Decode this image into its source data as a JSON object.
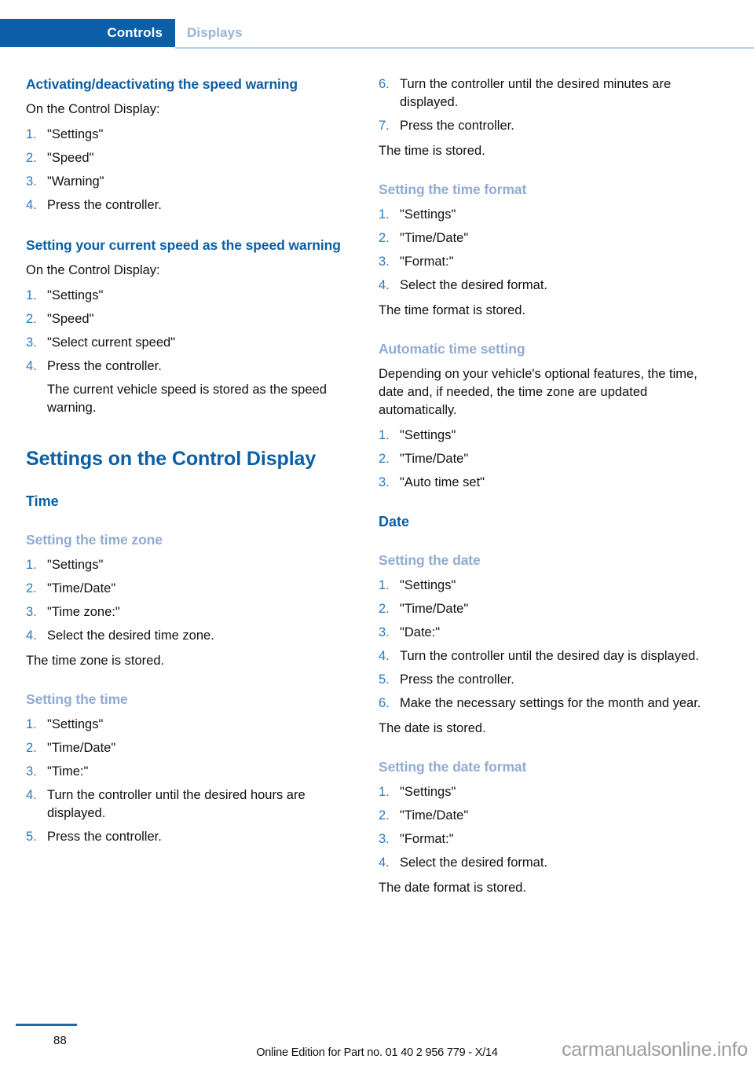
{
  "header": {
    "active_tab": "Controls",
    "inactive_tab": "Displays",
    "accent_color": "#0b5ea8",
    "inactive_color": "#97b4d6"
  },
  "colors": {
    "heading_blue": "#0b5fa5",
    "subheading_light_blue": "#90abd2",
    "list_number_blue": "#2a7ac0",
    "body_black": "#111111",
    "footer_rule_blue": "#1a6ab0",
    "watermark_grey": "#9d9d9d"
  },
  "left_column": {
    "section_speed_warning_toggle": {
      "heading": "Activating/deactivating the speed warning",
      "intro": "On the Control Display:",
      "steps": [
        {
          "num": "1.",
          "text": "\"Settings\""
        },
        {
          "num": "2.",
          "text": "\"Speed\""
        },
        {
          "num": "3.",
          "text": "\"Warning\""
        },
        {
          "num": "4.",
          "text": "Press the controller."
        }
      ]
    },
    "section_current_speed": {
      "heading": "Setting your current speed as the speed warning",
      "intro": "On the Control Display:",
      "steps": [
        {
          "num": "1.",
          "text": "\"Settings\""
        },
        {
          "num": "2.",
          "text": "\"Speed\""
        },
        {
          "num": "3.",
          "text": "\"Select current speed\""
        },
        {
          "num": "4.",
          "text": "Press the controller."
        }
      ],
      "note": "The current vehicle speed is stored as the speed warning."
    },
    "chapter_title": "Settings on the Control Display",
    "section_time_group": {
      "heading": "Time"
    },
    "section_time_zone": {
      "heading": "Setting the time zone",
      "steps": [
        {
          "num": "1.",
          "text": "\"Settings\""
        },
        {
          "num": "2.",
          "text": "\"Time/Date\""
        },
        {
          "num": "3.",
          "text": "\"Time zone:\""
        },
        {
          "num": "4.",
          "text": "Select the desired time zone."
        }
      ],
      "result": "The time zone is stored."
    },
    "section_setting_time": {
      "heading": "Setting the time",
      "steps": [
        {
          "num": "1.",
          "text": "\"Settings\""
        },
        {
          "num": "2.",
          "text": "\"Time/Date\""
        },
        {
          "num": "3.",
          "text": "\"Time:\""
        },
        {
          "num": "4.",
          "text": "Turn the controller until the desired hours are displayed."
        },
        {
          "num": "5.",
          "text": "Press the controller."
        }
      ]
    }
  },
  "right_column": {
    "section_setting_time_continued": {
      "steps": [
        {
          "num": "6.",
          "text": "Turn the controller until the desired mi­nutes are displayed."
        },
        {
          "num": "7.",
          "text": "Press the controller."
        }
      ],
      "result": "The time is stored."
    },
    "section_time_format": {
      "heading": "Setting the time format",
      "steps": [
        {
          "num": "1.",
          "text": "\"Settings\""
        },
        {
          "num": "2.",
          "text": "\"Time/Date\""
        },
        {
          "num": "3.",
          "text": "\"Format:\""
        },
        {
          "num": "4.",
          "text": "Select the desired format."
        }
      ],
      "result": "The time format is stored."
    },
    "section_automatic_time": {
      "heading": "Automatic time setting",
      "body": "Depending on your vehicle's optional features, the time, date and, if needed, the time zone are updated automatically.",
      "steps": [
        {
          "num": "1.",
          "text": "\"Settings\""
        },
        {
          "num": "2.",
          "text": "\"Time/Date\""
        },
        {
          "num": "3.",
          "text": "\"Auto time set\""
        }
      ]
    },
    "section_date_group": {
      "heading": "Date"
    },
    "section_setting_date": {
      "heading": "Setting the date",
      "steps": [
        {
          "num": "1.",
          "text": "\"Settings\""
        },
        {
          "num": "2.",
          "text": "\"Time/Date\""
        },
        {
          "num": "3.",
          "text": "\"Date:\""
        },
        {
          "num": "4.",
          "text": "Turn the controller until the desired day is displayed."
        },
        {
          "num": "5.",
          "text": "Press the controller."
        },
        {
          "num": "6.",
          "text": "Make the necessary settings for the month and year."
        }
      ],
      "result": "The date is stored."
    },
    "section_date_format": {
      "heading": "Setting the date format",
      "steps": [
        {
          "num": "1.",
          "text": "\"Settings\""
        },
        {
          "num": "2.",
          "text": "\"Time/Date\""
        },
        {
          "num": "3.",
          "text": "\"Format:\""
        },
        {
          "num": "4.",
          "text": "Select the desired format."
        }
      ],
      "result": "The date format is stored."
    }
  },
  "footer": {
    "page_number": "88",
    "edition_line": "Online Edition for Part no. 01 40 2 956 779 - X/14",
    "watermark": "carmanualsonline.info"
  }
}
